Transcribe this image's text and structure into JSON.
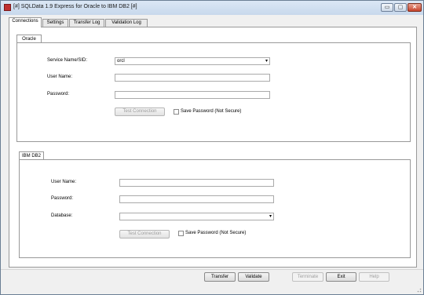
{
  "window": {
    "title": "[#] SQLData 1.9 Express for Oracle to IBM DB2 [#]",
    "controls": {
      "minimize": "▭",
      "maximize": "▢",
      "close": "✕"
    }
  },
  "tabs": [
    {
      "label": "Connections",
      "active": true
    },
    {
      "label": "Settings",
      "active": false
    },
    {
      "label": "Transfer Log",
      "active": false
    },
    {
      "label": "Validation Log",
      "active": false
    }
  ],
  "oracle": {
    "group_label": "Oracle",
    "service_label": "Service Name/SID:",
    "service_value": "orcl",
    "user_label": "User Name:",
    "user_value": "",
    "password_label": "Password:",
    "password_value": "",
    "test_button": "Test Connection",
    "save_password": "Save Password (Not Secure)"
  },
  "db2": {
    "group_label": "IBM DB2",
    "user_label": "User Name:",
    "user_value": "",
    "password_label": "Password:",
    "password_value": "",
    "database_label": "Database:",
    "database_value": "",
    "test_button": "Test Connection",
    "save_password": "Save Password (Not Secure)"
  },
  "buttons": {
    "transfer": "Transfer",
    "validate": "Validate",
    "terminate": "Terminate",
    "exit": "Exit",
    "help": "Help"
  },
  "icons": {
    "dropdown": "▾"
  }
}
